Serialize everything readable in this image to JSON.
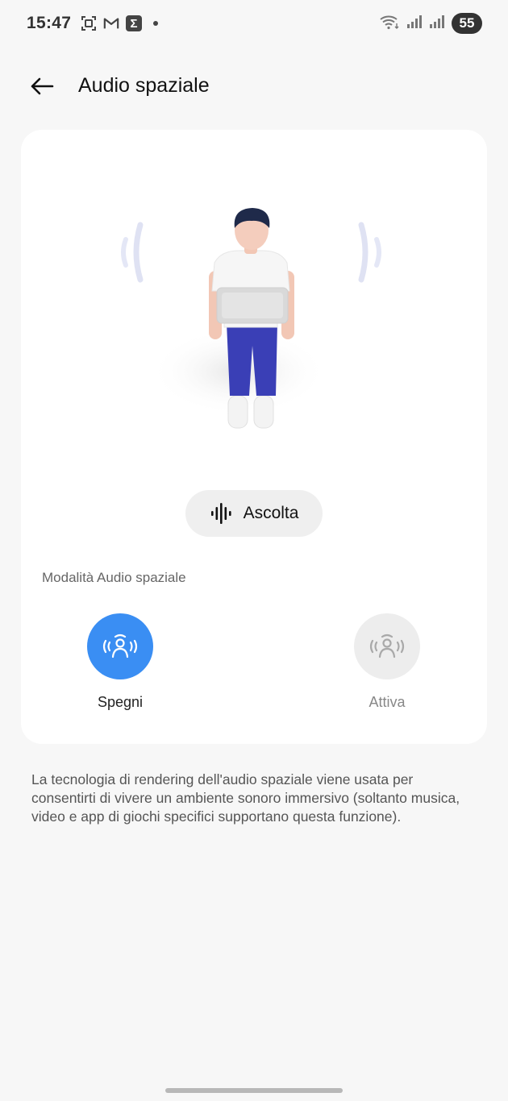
{
  "status_bar": {
    "time": "15:47",
    "left_icons": [
      "screenshot-icon",
      "gmail-icon",
      "sigma-app-icon",
      "notification-dot-icon"
    ],
    "right_icons": [
      "wifi-icon",
      "signal-icon",
      "signal-icon"
    ],
    "battery": "55"
  },
  "header": {
    "back_icon": "arrow-left-icon",
    "title": "Audio spaziale"
  },
  "card": {
    "listen_button": {
      "icon": "soundwave-icon",
      "label": "Ascolta"
    },
    "section_label": "Modalità Audio spaziale",
    "modes": [
      {
        "label": "Spegni",
        "selected": true,
        "icon": "spatial-audio-icon"
      },
      {
        "label": "Attiva",
        "selected": false,
        "icon": "spatial-audio-icon"
      }
    ]
  },
  "description": "La tecnologia di rendering dell'audio spaziale viene usata per consentirti di vivere un ambiente sonoro immersivo (soltanto musica, video e app di giochi specifici supportano questa funzione).",
  "colors": {
    "accent": "#3a8ef3",
    "background": "#f7f7f7",
    "card": "#ffffff"
  }
}
